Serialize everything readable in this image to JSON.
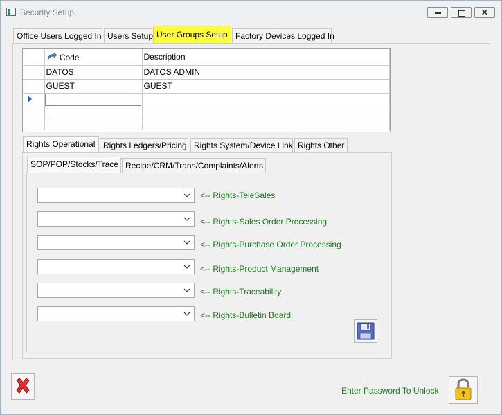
{
  "window": {
    "title": "Security Setup",
    "close_glyph": "✕"
  },
  "top_tabs": [
    {
      "label": "Office Users Logged In"
    },
    {
      "label": "Users Setup"
    },
    {
      "label": "User Groups Setup",
      "highlighted": true
    },
    {
      "label": "Factory Devices Logged In"
    }
  ],
  "grid": {
    "columns": [
      "Code",
      "Description"
    ],
    "rows": [
      {
        "code": "DATOS",
        "description": "DATOS ADMIN"
      },
      {
        "code": "GUEST",
        "description": "GUEST"
      }
    ]
  },
  "rights_tabs": [
    {
      "label": "Rights Operational"
    },
    {
      "label": "Rights Ledgers/Pricing"
    },
    {
      "label": "Rights System/Device Link"
    },
    {
      "label": "Rights Other"
    }
  ],
  "sub_tabs": [
    {
      "label": "SOP/POP/Stocks/Trace"
    },
    {
      "label": "Recipe/CRM/Trans/Complaints/Alerts"
    }
  ],
  "rights": [
    {
      "label": "<-- Rights-TeleSales",
      "value": ""
    },
    {
      "label": "<-- Rights-Sales Order Processing",
      "value": ""
    },
    {
      "label": "<-- Rights-Purchase Order Processing",
      "value": ""
    },
    {
      "label": "<-- Rights-Product Management",
      "value": ""
    },
    {
      "label": "<-- Rights-Traceability",
      "value": ""
    },
    {
      "label": "<-- Rights-Bulletin Board",
      "value": ""
    }
  ],
  "footer": {
    "unlock_label": "Enter Password To Unlock"
  },
  "colors": {
    "tab_highlight": "#ffff3a",
    "rights_label": "#1e7a1e"
  },
  "icons": [
    "app-icon",
    "save-icon",
    "delete-icon",
    "padlock-icon",
    "chevron-down-icon",
    "row-pointer-icon"
  ]
}
